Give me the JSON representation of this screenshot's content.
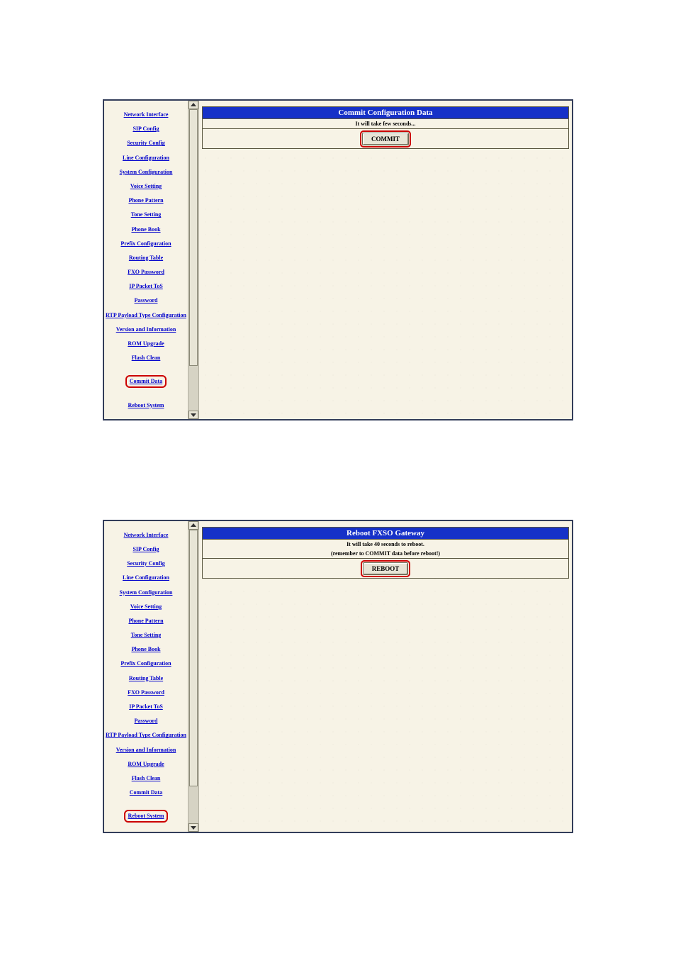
{
  "nav_items": [
    "Network Interface",
    "SIP Config",
    "Security Config",
    "Line Configuration",
    "System Configuration",
    "Voice Setting",
    "Phone Pattern",
    "Tone Setting",
    "Phone Book",
    "Prefix Configuration",
    "Routing Table",
    "FXO Password",
    "IP Packet ToS",
    "Password",
    "RTP Payload Type Configuration",
    "Version and Information",
    "ROM Upgrade",
    "Flash Clean",
    "Commit Data",
    "Reboot System"
  ],
  "shot1": {
    "selected_index": 18,
    "title": "Commit Configuration Data",
    "sub1": "It will take few seconds...",
    "button": "COMMIT"
  },
  "shot2": {
    "selected_index": 19,
    "title": "Reboot FXSO Gateway",
    "sub1": "It will take 40 seconds to reboot.",
    "sub2": "(remember to COMMIT data before reboot!)",
    "button": "REBOOT"
  }
}
